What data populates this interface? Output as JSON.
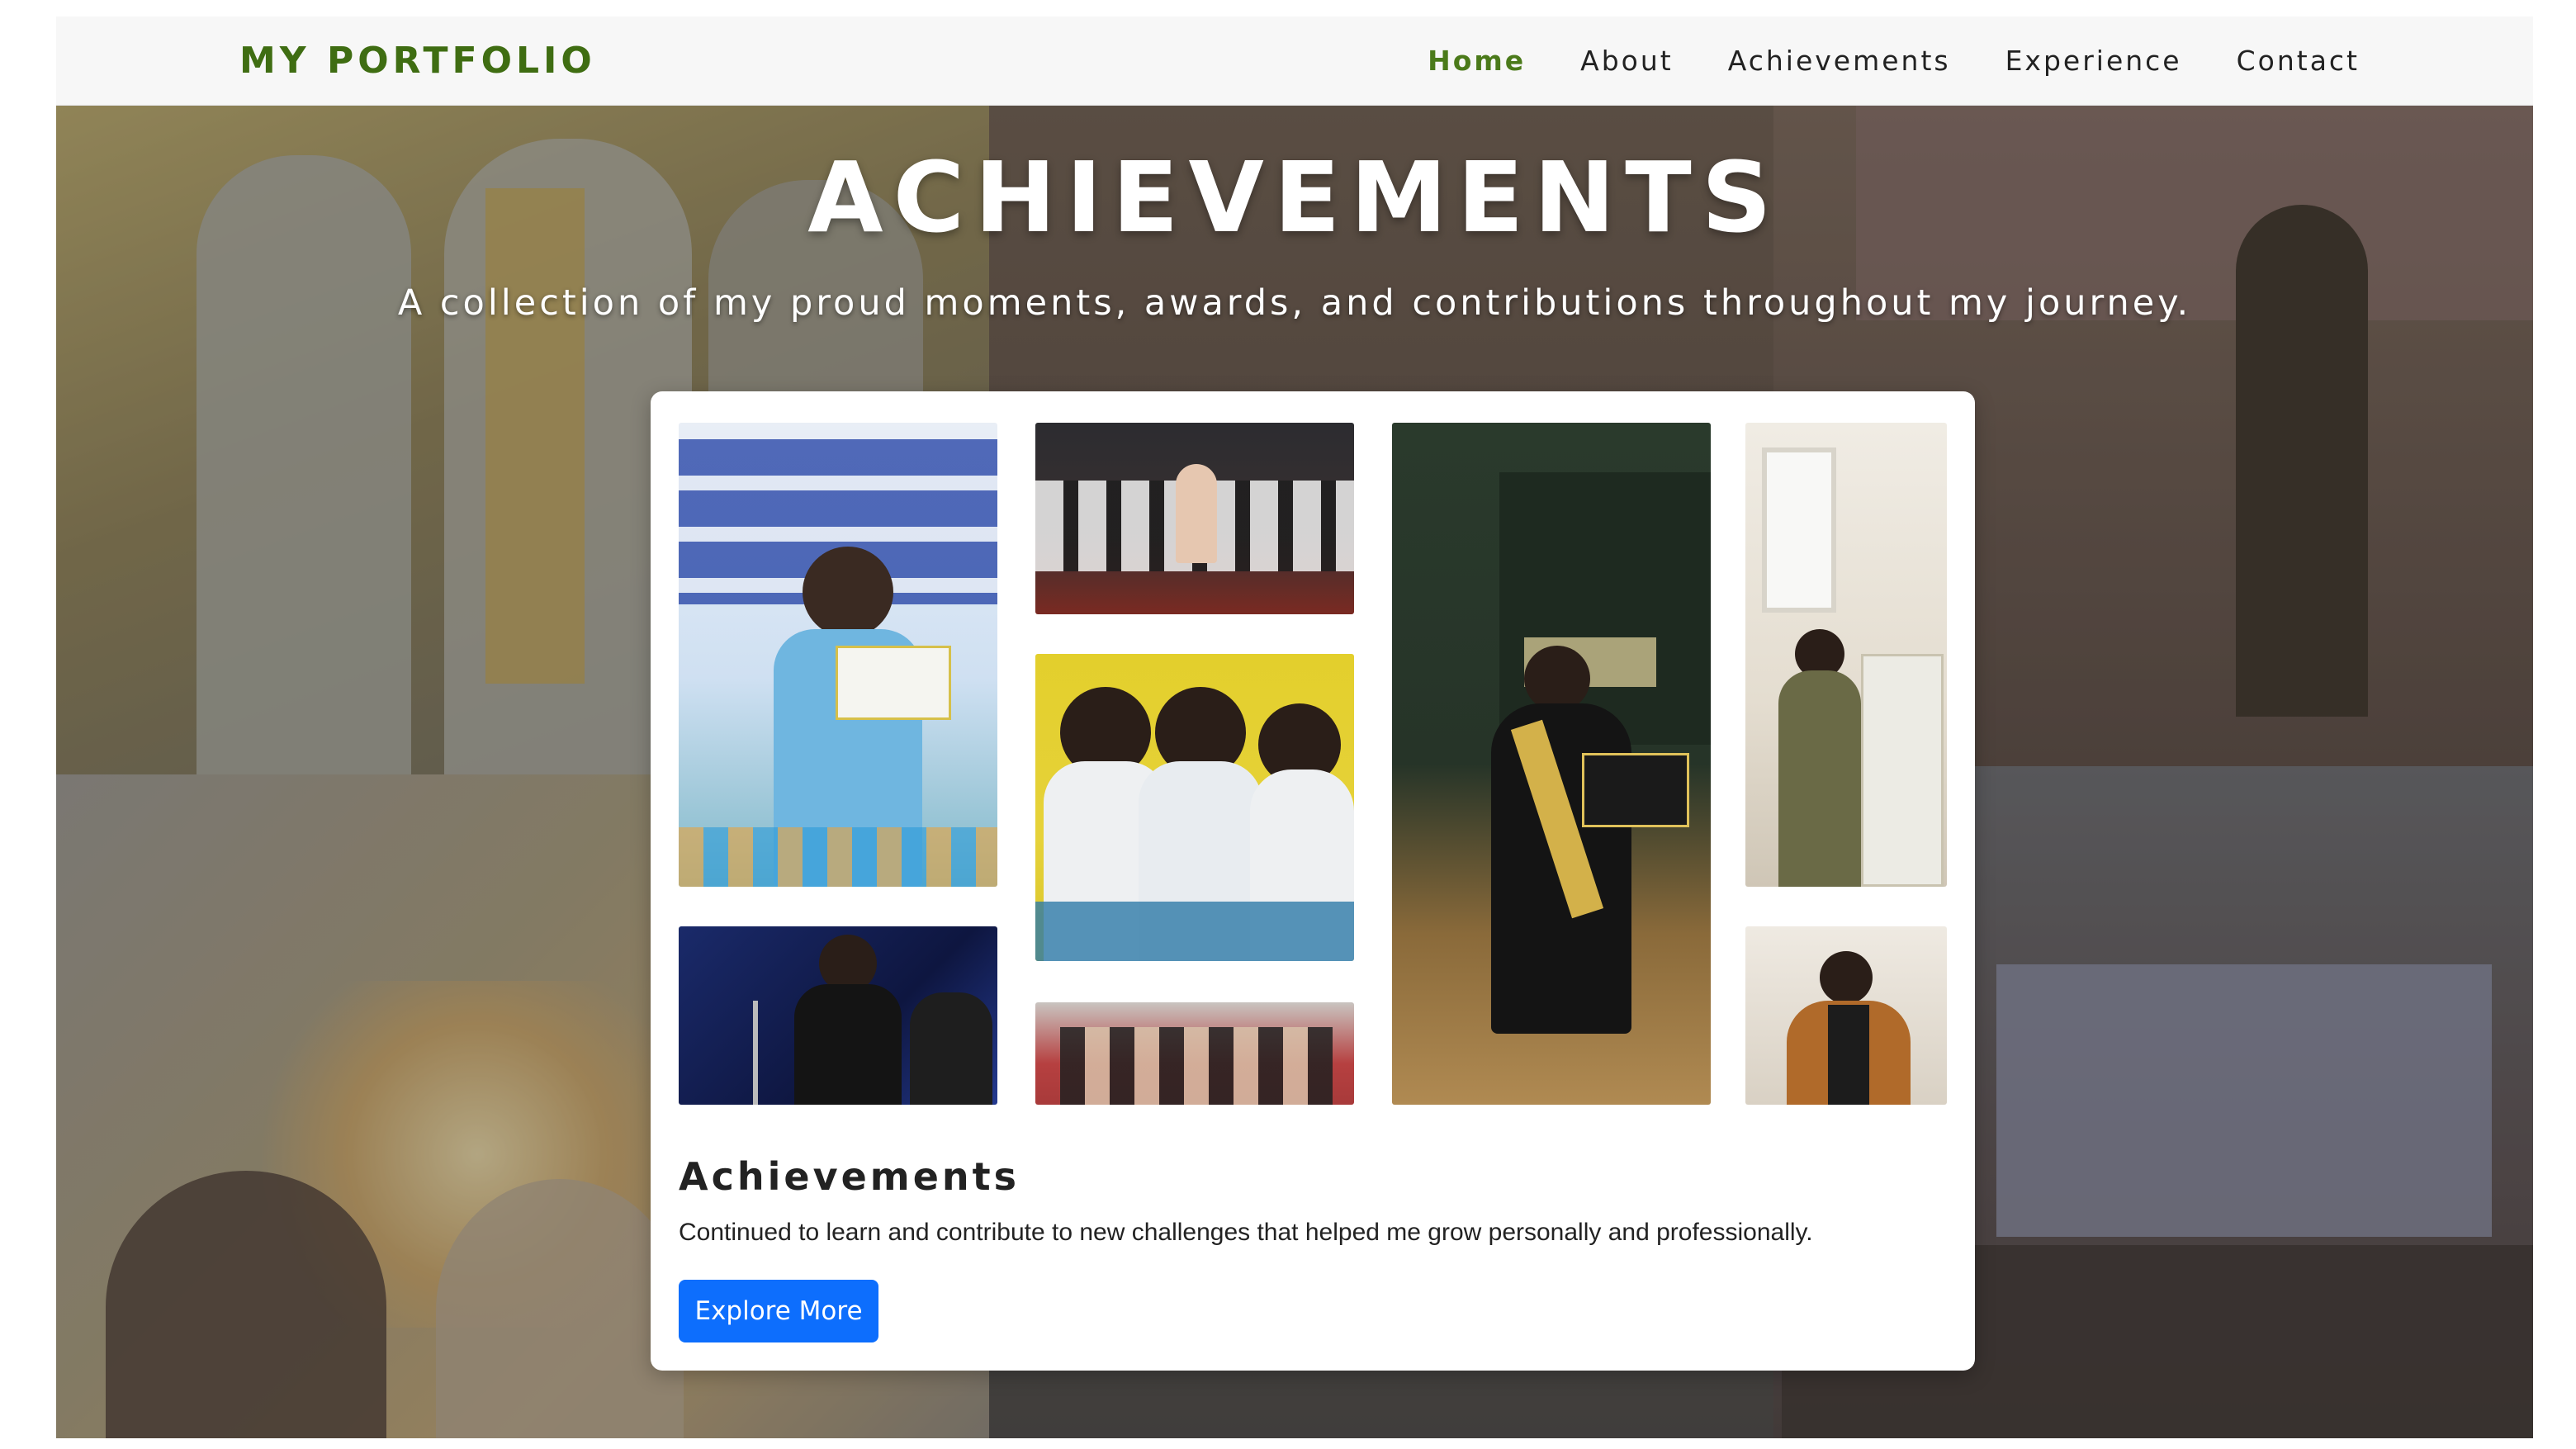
{
  "navbar": {
    "brand": "MY PORTFOLIO",
    "links": [
      "Home",
      "About",
      "Achievements",
      "Experience",
      "Contact"
    ],
    "active": "Home"
  },
  "hero": {
    "title": "ACHIEVEMENTS",
    "subtitle": "A collection of my proud moments, awards, and contributions throughout my journey."
  },
  "card": {
    "title": "Achievements",
    "description": "Continued to learn and contribute to new challenges that helped me grow personally and professionally.",
    "button_label": "Explore More"
  },
  "colors": {
    "brand_green": "#3f6d12",
    "button_blue": "#0d6efd"
  }
}
